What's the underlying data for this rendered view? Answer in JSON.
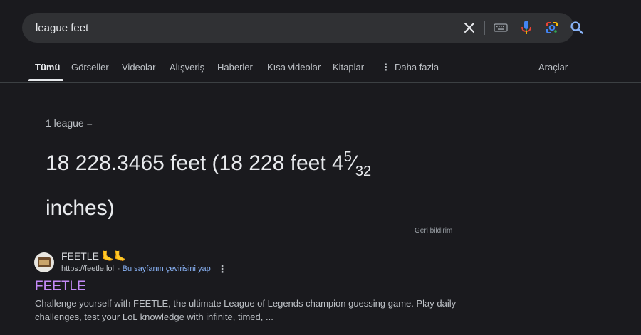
{
  "search": {
    "query": "league feet",
    "icons": [
      "close-icon",
      "keyboard-icon",
      "microphone-icon",
      "google-lens-icon",
      "search-icon"
    ]
  },
  "tabs": {
    "items": [
      {
        "label": "Tümü",
        "active": true
      },
      {
        "label": "Görseller"
      },
      {
        "label": "Videolar"
      },
      {
        "label": "Alışveriş"
      },
      {
        "label": "Haberler"
      },
      {
        "label": "Kısa videolar"
      },
      {
        "label": "Kitaplar"
      },
      {
        "label": "Daha fazla"
      }
    ],
    "tools": "Araçlar"
  },
  "converter": {
    "input_label": "1 league =",
    "result_main": "18 228.3465 feet (18 228 feet 4",
    "frac_num": "5",
    "frac_den": "32",
    "result_tail": "inches)",
    "feedback": "Geri bildirim"
  },
  "result": {
    "site_name": "FEETLE",
    "site_emoji": "🦶🦶",
    "url": "https://feetle.lol",
    "translate": "Bu sayfanın çevirisini yap",
    "title": "FEETLE",
    "snippet": "Challenge yourself with FEETLE, the ultimate League of Legends champion guessing game. Play daily challenges, test your LoL knowledge with infinite, timed, ..."
  },
  "colors": {
    "background": "#1a1a1e",
    "search_bg": "#303134",
    "link_visited": "#c58af9",
    "link": "#8ab4f8"
  }
}
